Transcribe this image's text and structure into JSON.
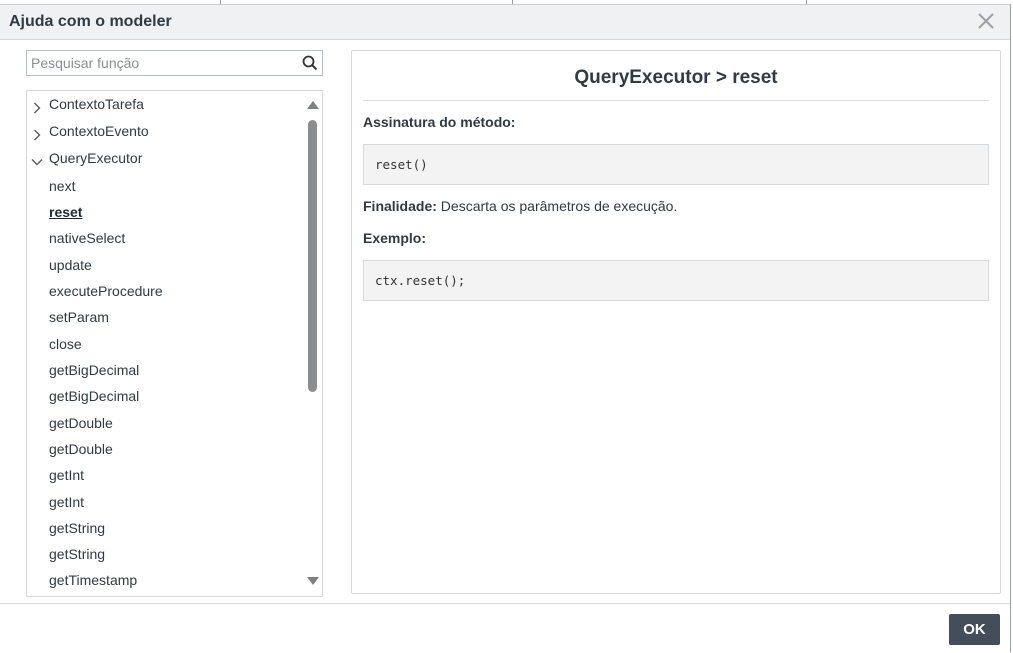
{
  "dialog": {
    "title": "Ajuda com o modeler",
    "ok_label": "OK"
  },
  "search": {
    "placeholder": "Pesquisar função"
  },
  "tree": {
    "items": [
      {
        "label": "ContextoTarefa",
        "level": 0,
        "expanded": false
      },
      {
        "label": "ContextoEvento",
        "level": 0,
        "expanded": false
      },
      {
        "label": "QueryExecutor",
        "level": 0,
        "expanded": true
      },
      {
        "label": "next",
        "level": 1
      },
      {
        "label": "reset",
        "level": 1,
        "active": true
      },
      {
        "label": "nativeSelect",
        "level": 1
      },
      {
        "label": "update",
        "level": 1
      },
      {
        "label": "executeProcedure",
        "level": 1
      },
      {
        "label": "setParam",
        "level": 1
      },
      {
        "label": "close",
        "level": 1
      },
      {
        "label": "getBigDecimal",
        "level": 1
      },
      {
        "label": "getBigDecimal",
        "level": 1
      },
      {
        "label": "getDouble",
        "level": 1
      },
      {
        "label": "getDouble",
        "level": 1
      },
      {
        "label": "getInt",
        "level": 1
      },
      {
        "label": "getInt",
        "level": 1
      },
      {
        "label": "getString",
        "level": 1
      },
      {
        "label": "getString",
        "level": 1
      },
      {
        "label": "getTimestamp",
        "level": 1
      }
    ]
  },
  "doc": {
    "title": "QueryExecutor > reset",
    "signature_label": "Assinatura do método:",
    "signature_code": "reset()",
    "purpose_label": "Finalidade:",
    "purpose_text": " Descarta os parâmetros de execução.",
    "example_label": "Exemplo:",
    "example_code": "ctx.reset();"
  }
}
